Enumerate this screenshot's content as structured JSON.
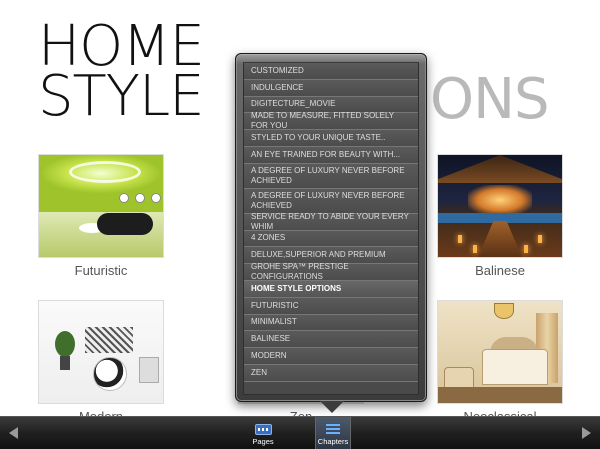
{
  "headline": {
    "line1": "HOME",
    "line2": "STYLE",
    "tail": "ONS"
  },
  "tiles": [
    {
      "caption": "Futuristic"
    },
    {
      "caption": "Balinese"
    },
    {
      "caption": "Modern"
    },
    {
      "caption": "Zen"
    },
    {
      "caption": "Neoclassical"
    }
  ],
  "chapters_menu": {
    "items": [
      "CUSTOMIZED",
      "INDULGENCE",
      "DIGITECTURE_MOVIE",
      "MADE TO MEASURE, FITTED SOLELY FOR YOU",
      "STYLED TO YOUR UNIQUE TASTE..",
      "AN EYE TRAINED FOR BEAUTY WITH...",
      "A DEGREE OF LUXURY NEVER BEFORE ACHIEVED",
      "A DEGREE OF LUXURY NEVER BEFORE ACHIEVED",
      "SERVICE READY TO ABIDE YOUR EVERY WHIM",
      "4 ZONES",
      "DELUXE,SUPERIOR AND PREMIUM",
      "GROHE SPA™ PRESTIGE CONFIGURATIONS",
      "HOME STYLE OPTIONS",
      "FUTURISTIC",
      "MINIMALIST",
      "BALINESE",
      "MODERN",
      "ZEN"
    ],
    "active_item": "HOME STYLE OPTIONS"
  },
  "toolbar": {
    "pages_label": "Pages",
    "chapters_label": "Chapters",
    "active_tab": "Chapters"
  },
  "icons": {
    "prev": "chevron-left-icon",
    "next": "chevron-right-icon",
    "pages": "pages-grid-icon",
    "chapters": "chapters-list-icon"
  }
}
